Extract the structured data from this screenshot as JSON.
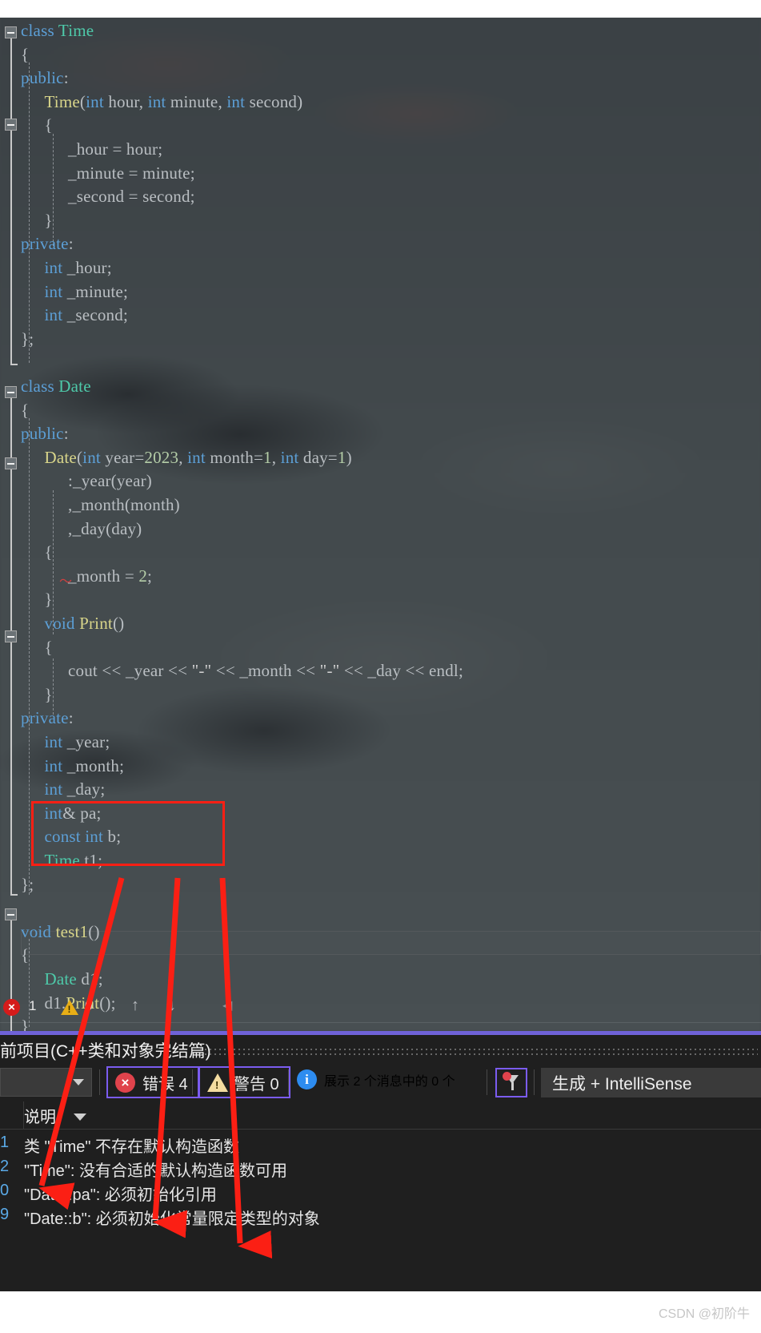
{
  "editor": {
    "language": "cpp",
    "lines": [
      {
        "indent": 0,
        "tokens": [
          {
            "t": "class ",
            "c": "kw"
          },
          {
            "t": "Time",
            "c": "typ"
          }
        ]
      },
      {
        "indent": 0,
        "tokens": [
          {
            "t": "{",
            "c": "pl"
          }
        ]
      },
      {
        "indent": 0,
        "tokens": [
          {
            "t": "public",
            "c": "kw"
          },
          {
            "t": ":",
            "c": "pl"
          }
        ]
      },
      {
        "indent": 1,
        "tokens": [
          {
            "t": "Time",
            "c": "fn"
          },
          {
            "t": "(",
            "c": "pl"
          },
          {
            "t": "int",
            "c": "kw"
          },
          {
            "t": " hour, ",
            "c": "pl"
          },
          {
            "t": "int",
            "c": "kw"
          },
          {
            "t": " minute, ",
            "c": "pl"
          },
          {
            "t": "int",
            "c": "kw"
          },
          {
            "t": " second)",
            "c": "pl"
          }
        ]
      },
      {
        "indent": 1,
        "tokens": [
          {
            "t": "{",
            "c": "pl"
          }
        ]
      },
      {
        "indent": 2,
        "tokens": [
          {
            "t": "_hour = hour;",
            "c": "pl"
          }
        ]
      },
      {
        "indent": 2,
        "tokens": [
          {
            "t": "_minute = minute;",
            "c": "pl"
          }
        ]
      },
      {
        "indent": 2,
        "tokens": [
          {
            "t": "_second = second;",
            "c": "pl"
          }
        ]
      },
      {
        "indent": 1,
        "tokens": [
          {
            "t": "}",
            "c": "pl"
          }
        ]
      },
      {
        "indent": 0,
        "tokens": [
          {
            "t": "private",
            "c": "kw"
          },
          {
            "t": ":",
            "c": "pl"
          }
        ]
      },
      {
        "indent": 1,
        "tokens": [
          {
            "t": "int",
            "c": "kw"
          },
          {
            "t": " _hour;",
            "c": "pl"
          }
        ]
      },
      {
        "indent": 1,
        "tokens": [
          {
            "t": "int",
            "c": "kw"
          },
          {
            "t": " _minute;",
            "c": "pl"
          }
        ]
      },
      {
        "indent": 1,
        "tokens": [
          {
            "t": "int",
            "c": "kw"
          },
          {
            "t": " _second;",
            "c": "pl"
          }
        ]
      },
      {
        "indent": 0,
        "tokens": [
          {
            "t": "};",
            "c": "pl"
          }
        ]
      },
      {
        "indent": 0,
        "tokens": []
      },
      {
        "indent": 0,
        "tokens": [
          {
            "t": "class ",
            "c": "kw"
          },
          {
            "t": "Date",
            "c": "typ"
          }
        ]
      },
      {
        "indent": 0,
        "tokens": [
          {
            "t": "{",
            "c": "pl"
          }
        ]
      },
      {
        "indent": 0,
        "tokens": [
          {
            "t": "public",
            "c": "kw"
          },
          {
            "t": ":",
            "c": "pl"
          }
        ]
      },
      {
        "indent": 1,
        "tokens": [
          {
            "t": "Date",
            "c": "fn"
          },
          {
            "t": "(",
            "c": "pl"
          },
          {
            "t": "int",
            "c": "kw"
          },
          {
            "t": " year=",
            "c": "pl"
          },
          {
            "t": "2023",
            "c": "num"
          },
          {
            "t": ", ",
            "c": "pl"
          },
          {
            "t": "int",
            "c": "kw"
          },
          {
            "t": " month=",
            "c": "pl"
          },
          {
            "t": "1",
            "c": "num"
          },
          {
            "t": ", ",
            "c": "pl"
          },
          {
            "t": "int",
            "c": "kw"
          },
          {
            "t": " day=",
            "c": "pl"
          },
          {
            "t": "1",
            "c": "num"
          },
          {
            "t": ")",
            "c": "pl"
          }
        ]
      },
      {
        "indent": 2,
        "tokens": [
          {
            "t": ":_year(year)",
            "c": "pl"
          }
        ]
      },
      {
        "indent": 2,
        "tokens": [
          {
            "t": ",_month(month)",
            "c": "pl"
          }
        ]
      },
      {
        "indent": 2,
        "tokens": [
          {
            "t": ",_day(day)",
            "c": "pl"
          }
        ]
      },
      {
        "indent": 1,
        "tokens": [
          {
            "t": "{",
            "c": "pl"
          }
        ]
      },
      {
        "indent": 2,
        "tokens": [
          {
            "t": "_month = ",
            "c": "pl"
          },
          {
            "t": "2",
            "c": "num"
          },
          {
            "t": ";",
            "c": "pl"
          }
        ]
      },
      {
        "indent": 1,
        "tokens": [
          {
            "t": "}",
            "c": "pl"
          }
        ]
      },
      {
        "indent": 1,
        "tokens": [
          {
            "t": "void",
            "c": "kw"
          },
          {
            "t": " ",
            "c": "pl"
          },
          {
            "t": "Print",
            "c": "fn"
          },
          {
            "t": "()",
            "c": "pl"
          }
        ]
      },
      {
        "indent": 1,
        "tokens": [
          {
            "t": "{",
            "c": "pl"
          }
        ]
      },
      {
        "indent": 2,
        "tokens": [
          {
            "t": "cout << _year << ",
            "c": "pl"
          },
          {
            "t": "\"-\"",
            "c": "str"
          },
          {
            "t": " << _month << ",
            "c": "pl"
          },
          {
            "t": "\"-\"",
            "c": "str"
          },
          {
            "t": " << _day << endl;",
            "c": "pl"
          }
        ]
      },
      {
        "indent": 1,
        "tokens": [
          {
            "t": "}",
            "c": "pl"
          }
        ]
      },
      {
        "indent": 0,
        "tokens": [
          {
            "t": "private",
            "c": "kw"
          },
          {
            "t": ":",
            "c": "pl"
          }
        ]
      },
      {
        "indent": 1,
        "tokens": [
          {
            "t": "int",
            "c": "kw"
          },
          {
            "t": " _year;",
            "c": "pl"
          }
        ]
      },
      {
        "indent": 1,
        "tokens": [
          {
            "t": "int",
            "c": "kw"
          },
          {
            "t": " _month;",
            "c": "pl"
          }
        ]
      },
      {
        "indent": 1,
        "tokens": [
          {
            "t": "int",
            "c": "kw"
          },
          {
            "t": " _day;",
            "c": "pl"
          }
        ]
      },
      {
        "indent": 1,
        "tokens": [
          {
            "t": "int",
            "c": "kw"
          },
          {
            "t": "& pa;",
            "c": "pl"
          }
        ]
      },
      {
        "indent": 1,
        "tokens": [
          {
            "t": "const int",
            "c": "kw"
          },
          {
            "t": " b;",
            "c": "pl"
          }
        ]
      },
      {
        "indent": 1,
        "tokens": [
          {
            "t": "Time",
            "c": "typ"
          },
          {
            "t": " t1;",
            "c": "pl"
          }
        ]
      },
      {
        "indent": 0,
        "tokens": [
          {
            "t": "};",
            "c": "pl"
          }
        ]
      },
      {
        "indent": 0,
        "tokens": []
      },
      {
        "indent": 0,
        "tokens": [
          {
            "t": "void",
            "c": "kw"
          },
          {
            "t": " ",
            "c": "pl"
          },
          {
            "t": "test1",
            "c": "fn"
          },
          {
            "t": "()",
            "c": "pl"
          }
        ]
      },
      {
        "indent": 0,
        "tokens": [
          {
            "t": "{",
            "c": "pl"
          }
        ]
      },
      {
        "indent": 1,
        "tokens": [
          {
            "t": "Date",
            "c": "typ"
          },
          {
            "t": " d1;",
            "c": "pl"
          }
        ]
      },
      {
        "indent": 1,
        "tokens": [
          {
            "t": "d1.",
            "c": "pl"
          },
          {
            "t": "Print",
            "c": "fn"
          },
          {
            "t": "()",
            "c": "pl"
          },
          {
            "t": ";",
            "c": "pl"
          }
        ]
      },
      {
        "indent": 0,
        "tokens": [
          {
            "t": "}",
            "c": "pl"
          }
        ]
      }
    ],
    "status": {
      "error_icon": "×",
      "error_count": "1",
      "warn_icon": "!",
      "warn_count": "0",
      "prev_arrow": "↑",
      "next_arrow": "↓",
      "left_arrow": "◀"
    }
  },
  "panel": {
    "title": "前项目(C++类和对象完结篇)",
    "toolbar": {
      "scope_value": "",
      "errors_label": "错误 4",
      "warnings_label": "警告 0",
      "messages_label": "展示 2 个消息中的 0 个",
      "info_icon_glyph": "i",
      "error_icon_glyph": "×",
      "warn_icon_glyph": "!",
      "build_selector": "生成 + IntelliSense"
    },
    "columns": {
      "code_header": "",
      "description_header": "说明"
    },
    "rows": [
      {
        "code": "1",
        "desc": "类 \"Time\" 不存在默认构造函数"
      },
      {
        "code": "2",
        "desc": "\"Time\": 没有合适的默认构造函数可用"
      },
      {
        "code": "0",
        "desc": "\"Date::pa\": 必须初始化引用"
      },
      {
        "code": "9",
        "desc": "\"Date::b\": 必须初始化常量限定类型的对象"
      }
    ]
  },
  "watermark": {
    "text": "CSDN @初阶牛"
  },
  "colors": {
    "editor_bg": "#3f4548",
    "panel_bg": "#1f1f1f",
    "accent_purple": "#6f62d8",
    "highlight_red": "#fb1f14",
    "error_red": "#d51b1b",
    "warn_yellow": "#e8ae16",
    "info_blue": "#2d8cf0",
    "keyword_blue": "#5c9fd6",
    "type_green": "#4ec9a9",
    "function_yellow": "#d8d58a",
    "number_green": "#b5cea8"
  }
}
